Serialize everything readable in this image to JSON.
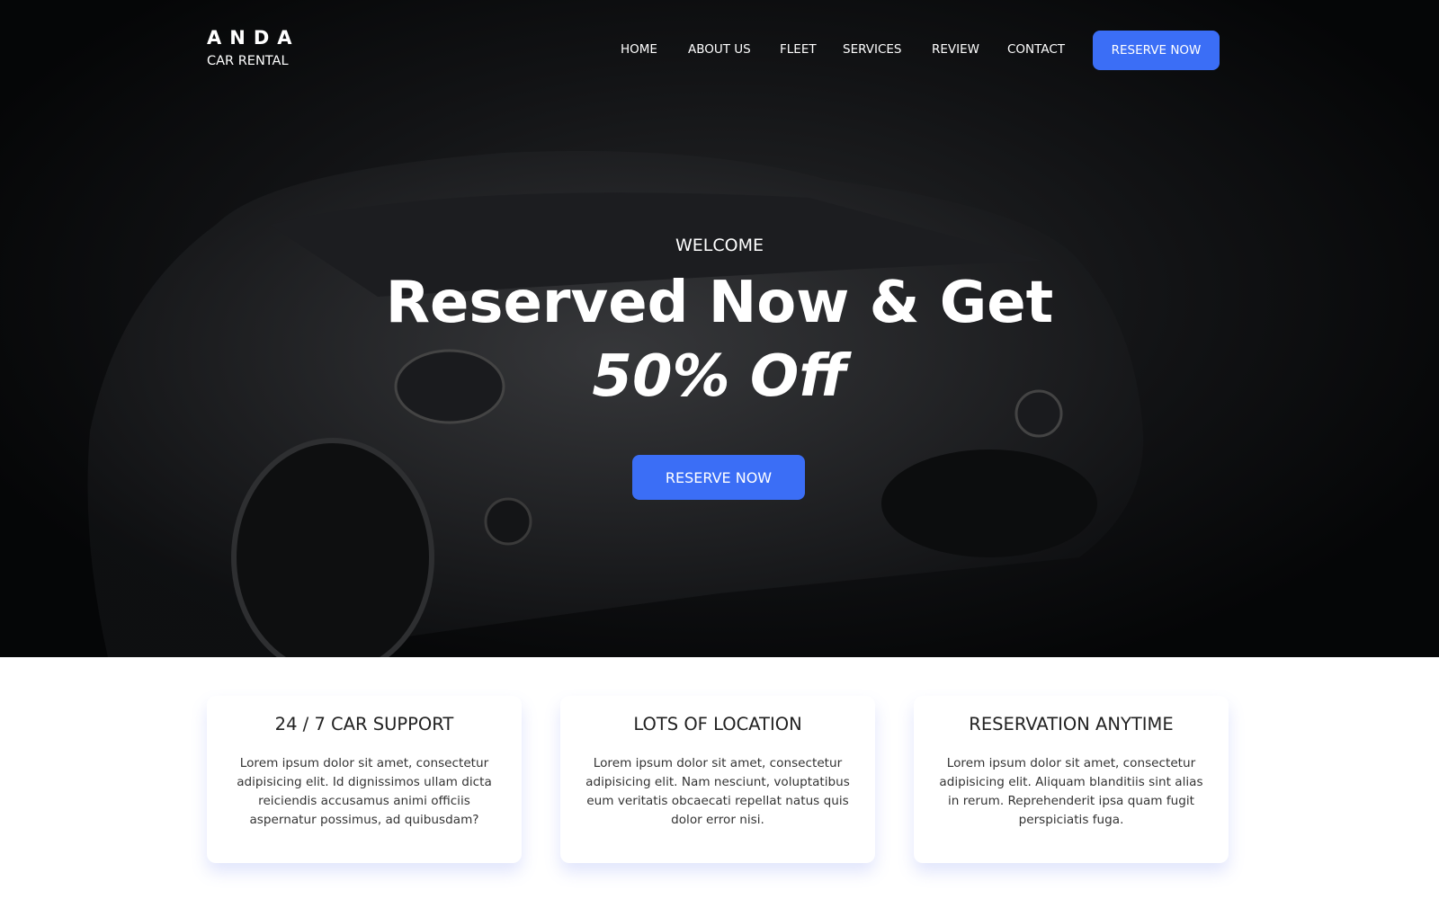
{
  "brand": {
    "name": "ANDA",
    "subtitle": "CAR RENTAL"
  },
  "nav": {
    "items": [
      "HOME",
      "ABOUT US",
      "FLEET",
      "SERVICES",
      "REVIEW",
      "CONTACT"
    ],
    "cta": "RESERVE NOW"
  },
  "hero": {
    "eyebrow": "WELCOME",
    "headline": "Reserved Now & Get",
    "highlight": "50% Off",
    "cta": "RESERVE NOW"
  },
  "colors": {
    "accent": "#3b6ef6",
    "hero_bg": "#0a0b0d"
  },
  "features": [
    {
      "title": "24 / 7 CAR SUPPORT",
      "text": "Lorem ipsum dolor sit amet, consectetur adipisicing elit. Id dignissimos ullam dicta reiciendis accusamus animi officiis aspernatur possimus, ad quibusdam?"
    },
    {
      "title": "LOTS OF LOCATION",
      "text": "Lorem ipsum dolor sit amet, consectetur adipisicing elit. Nam nesciunt, voluptatibus eum veritatis obcaecati repellat natus quis dolor error nisi."
    },
    {
      "title": "RESERVATION ANYTIME",
      "text": "Lorem ipsum dolor sit amet, consectetur adipisicing elit. Aliquam blanditiis sint alias in rerum. Reprehenderit ipsa quam fugit perspiciatis fuga."
    }
  ]
}
